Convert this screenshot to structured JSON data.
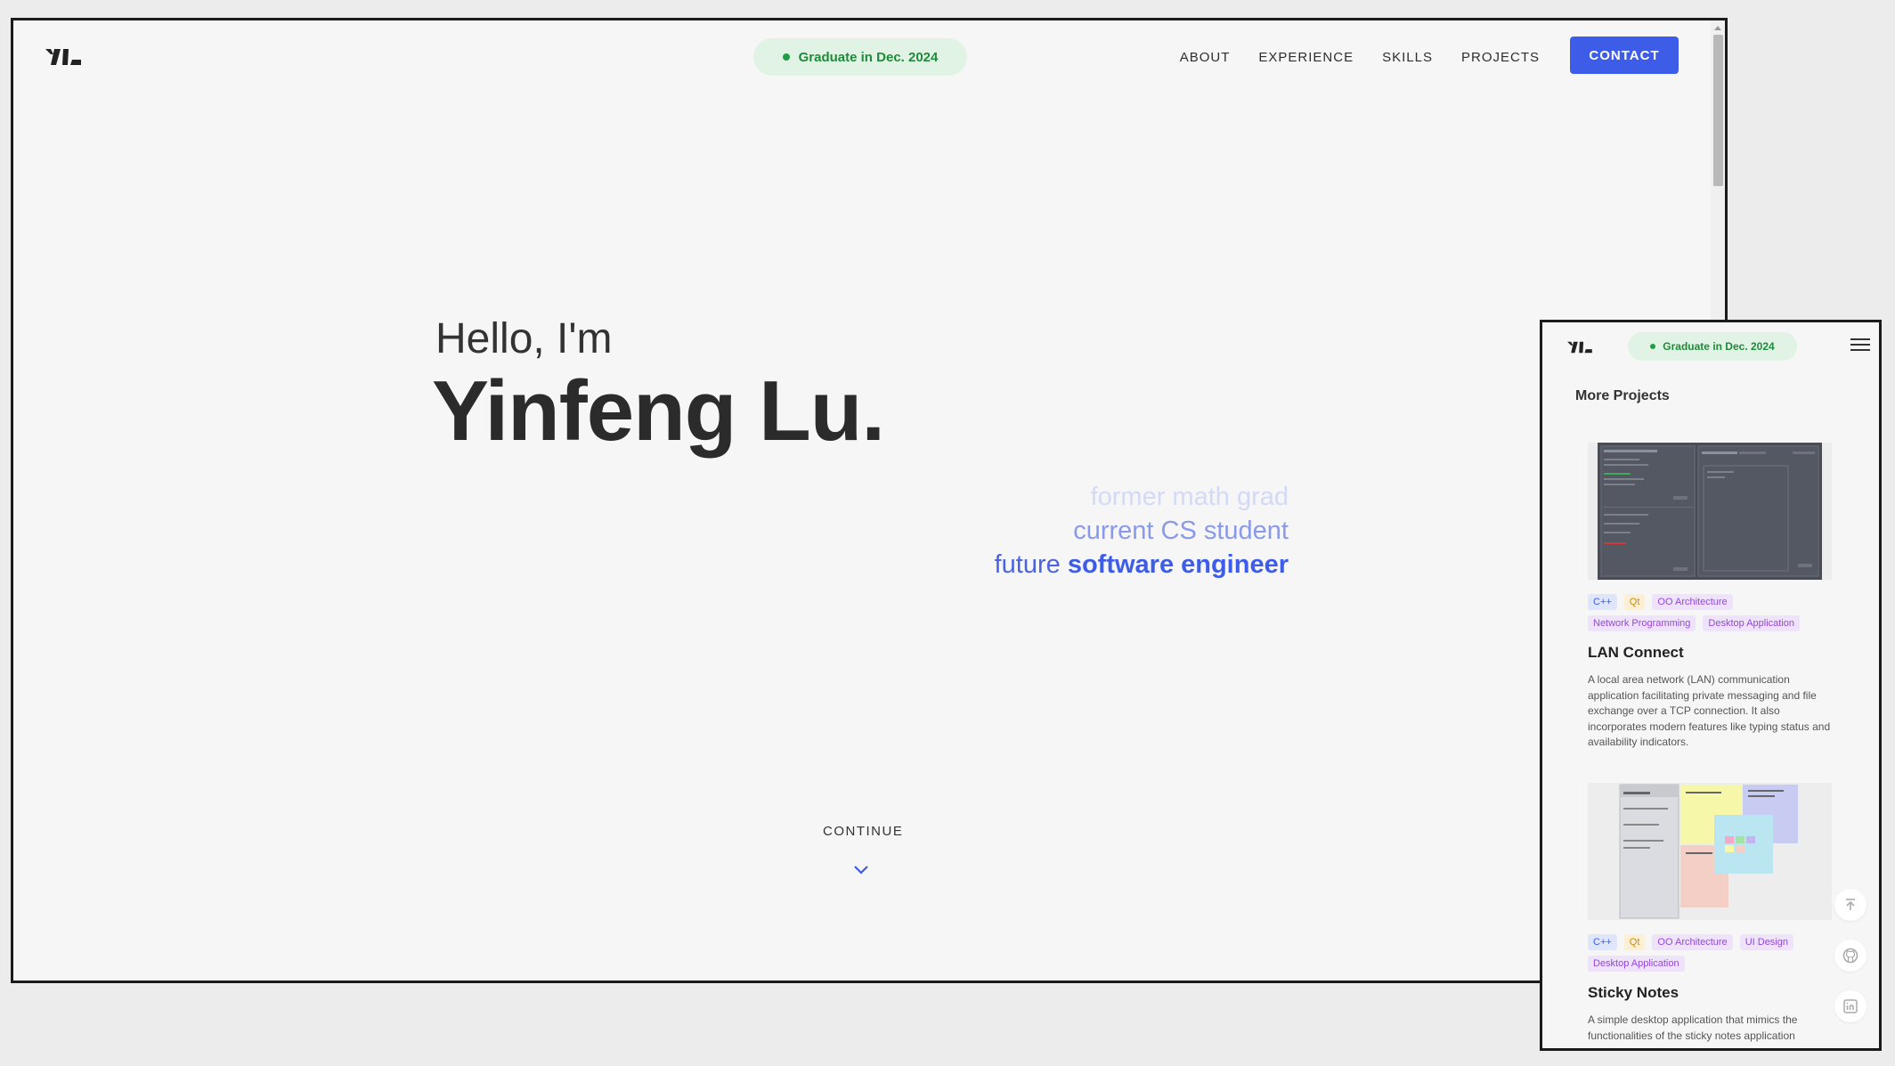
{
  "desktop": {
    "badge": "Graduate in Dec. 2024",
    "nav": [
      "ABOUT",
      "EXPERIENCE",
      "SKILLS",
      "PROJECTS"
    ],
    "contact": "CONTACT",
    "hello": "Hello, I'm",
    "name": "Yinfeng Lu.",
    "roles": {
      "former": "former math grad",
      "current": "current CS student",
      "future_prefix": "future",
      "future_emph": "software engineer"
    },
    "continue": "CONTINUE"
  },
  "mobile": {
    "badge": "Graduate in Dec. 2024",
    "section_title": "More Projects",
    "projects": [
      {
        "title": "LAN Connect",
        "tags": [
          "C++",
          "Qt",
          "OO Architecture",
          "Network Programming",
          "Desktop Application"
        ],
        "description": "A local area network (LAN) communication application facilitating private messaging and file exchange over a TCP connection. It also incorporates modern features like typing status and availability indicators."
      },
      {
        "title": "Sticky Notes",
        "tags": [
          "C++",
          "Qt",
          "OO Architecture",
          "UI Design",
          "Desktop Application"
        ],
        "description": "A simple desktop application that mimics the functionalities of the sticky notes application"
      }
    ],
    "fab_icons": [
      "arrow-up-to-top-icon",
      "github-icon",
      "linkedin-icon"
    ]
  },
  "colors": {
    "accent": "#3d5ce8",
    "badge_bg": "#e1f3e5",
    "badge_text": "#1f8a3a",
    "page_bg": "#f6f6f6"
  }
}
